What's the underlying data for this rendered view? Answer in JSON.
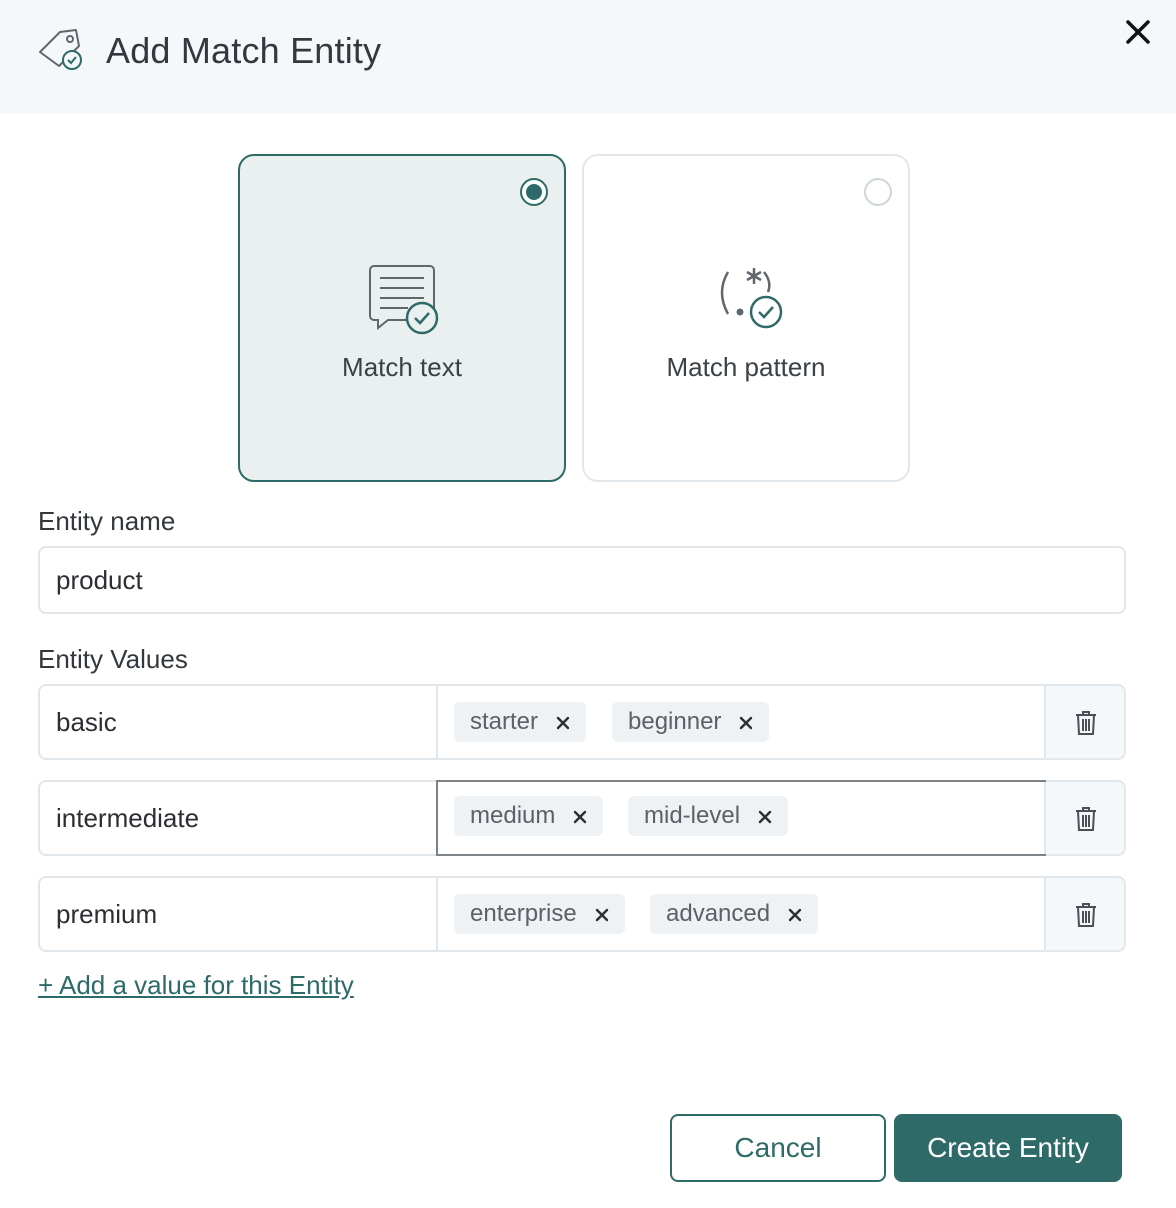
{
  "dialog": {
    "title": "Add Match Entity",
    "header_icon": "tag-check-icon",
    "close_icon": "close-icon"
  },
  "match_type": {
    "selected": "match_text",
    "options": [
      {
        "label": "Match text",
        "icon": "text-bubble-check-icon",
        "selected": true
      },
      {
        "label": "Match pattern",
        "icon": "regex-pattern-check-icon",
        "selected": false
      }
    ]
  },
  "entity_name": {
    "label": "Entity name",
    "value": "product"
  },
  "entity_values": {
    "label": "Entity Values",
    "rows": [
      {
        "value": "basic",
        "synonyms": [
          "starter",
          "beginner"
        ]
      },
      {
        "value": "intermediate",
        "synonyms": [
          "medium",
          "mid-level"
        ]
      },
      {
        "value": "premium",
        "synonyms": [
          "enterprise",
          "advanced"
        ]
      }
    ],
    "add_link": "+ Add a value for this Entity"
  },
  "actions": {
    "cancel": "Cancel",
    "create": "Create Entity"
  },
  "colors": {
    "accent": "#2e6b68",
    "header_bg": "#f4f8fa",
    "selected_card_bg": "#eaf0ef",
    "border": "#e1e7ea",
    "chip_bg": "#eef2f5"
  }
}
